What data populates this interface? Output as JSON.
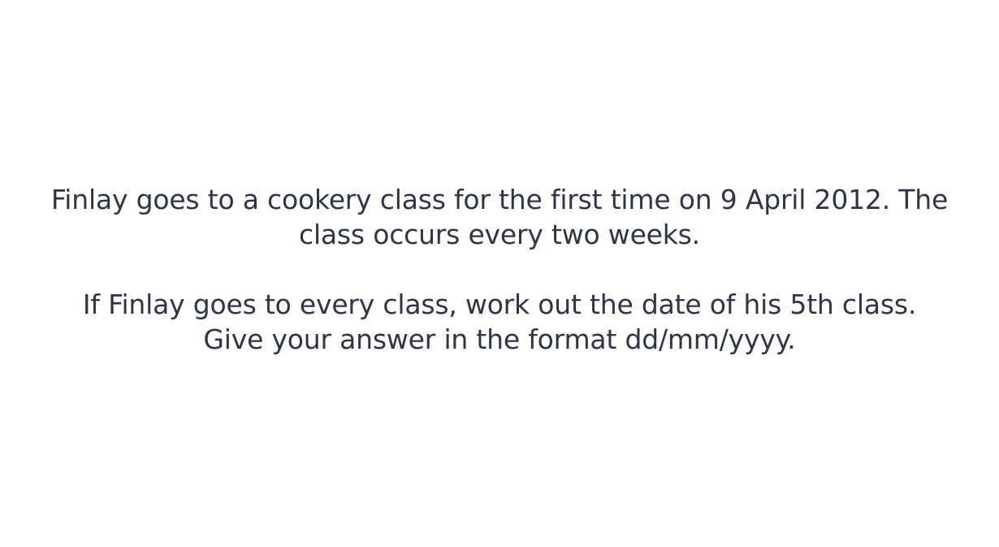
{
  "question": {
    "paragraph_1": {
      "line_1": "Finlay goes to a cookery class for the first time on 9 April 2012. The",
      "line_2": "class occurs every two weeks."
    },
    "paragraph_2": {
      "line_1": "If Finlay goes to every class, work out the date of his 5th class.",
      "line_2": "Give your answer in the format dd/mm/yyyy."
    }
  }
}
